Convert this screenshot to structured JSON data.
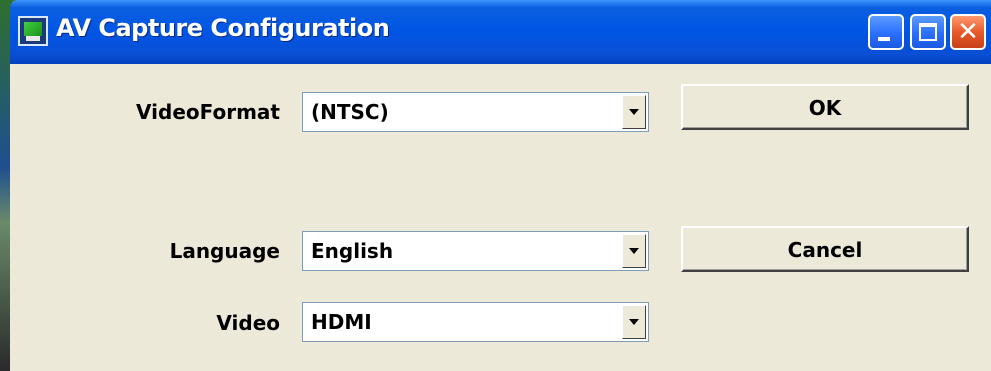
{
  "window": {
    "title": "AV Capture Configuration",
    "titlebar_color": "#0055e5",
    "client_bg": "#ece9d8"
  },
  "titlebar_buttons": {
    "minimize_icon": "minimize-icon",
    "maximize_icon": "maximize-icon",
    "close_icon": "close-icon",
    "close_glyph": "✕"
  },
  "form": {
    "video_format": {
      "label": "VideoFormat",
      "value": "(NTSC)"
    },
    "language": {
      "label": "Language",
      "value": "English"
    },
    "video": {
      "label": "Video",
      "value": "HDMI"
    }
  },
  "buttons": {
    "ok_label": "OK",
    "cancel_label": "Cancel"
  }
}
